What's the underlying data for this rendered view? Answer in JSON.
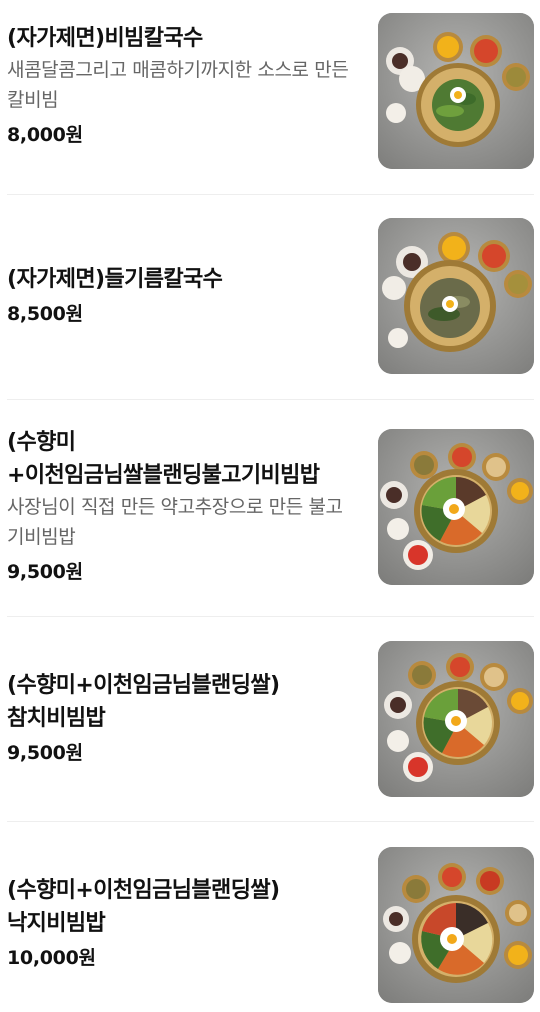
{
  "menu": {
    "items": [
      {
        "name": "(자가제면)비빔칼국수",
        "description": "새콤달콤그리고 매콤하기까지한 소스로 만든 칼비빔",
        "price": "8,000원",
        "image": "bibim-kalguksu-photo"
      },
      {
        "name": "(자가제면)들기름칼국수",
        "description": "",
        "price": "8,500원",
        "image": "perilla-oil-kalguksu-photo"
      },
      {
        "name": "(수향미+이천임금님쌀블랜딩불고기비빔밥",
        "description": "사장님이 직접 만든 약고추장으로 만든 불고기비빔밥",
        "price": "9,500원",
        "image": "bulgogi-bibimbap-photo"
      },
      {
        "name": "(수향미+이천임금님블랜딩쌀)참치비빔밥",
        "description": "",
        "price": "9,500원",
        "image": "tuna-bibimbap-photo"
      },
      {
        "name": "(수향미+이천임금님블랜딩쌀)낙지비빔밥",
        "description": "",
        "price": "10,000원",
        "image": "octopus-bibimbap-photo"
      }
    ]
  },
  "colors": {
    "text": "#111111",
    "description": "#666666",
    "divider": "#eeeeee",
    "photo_background": "#9a9a98",
    "brass_bowl": "#c9a45a"
  }
}
